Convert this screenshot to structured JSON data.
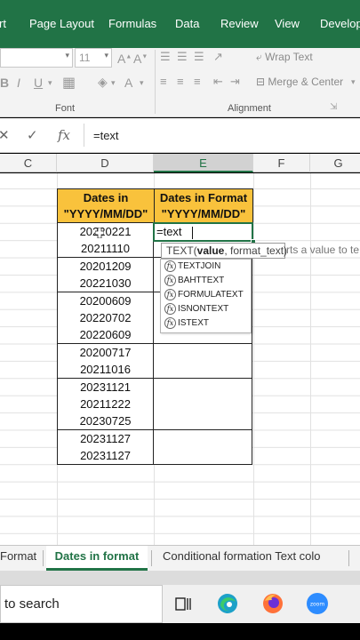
{
  "ribbon_tabs": [
    "rt",
    "Page Layout",
    "Formulas",
    "Data",
    "Review",
    "View",
    "Develope"
  ],
  "ribbon": {
    "font_size": "11",
    "font_group_label": "Font",
    "alignment_group_label": "Alignment",
    "wrap_text": "Wrap Text",
    "merge_center": "Merge & Center"
  },
  "formula_bar": {
    "value": "=text"
  },
  "column_headers": [
    "C",
    "D",
    "E",
    "F",
    "G"
  ],
  "active_column": "E",
  "table": {
    "header_d": [
      "Dates in",
      "\"YYYY/MM/DD\""
    ],
    "header_e": [
      "Dates in Format",
      "\"YYYY/MM/DD\""
    ],
    "dates": [
      "20220221",
      "20211110",
      "20201209",
      "20221030",
      "20200609",
      "20220702",
      "20220609",
      "20200717",
      "20211016",
      "20231121",
      "20211222",
      "20230725",
      "20231127",
      "20231127"
    ]
  },
  "active_cell_value": "=text",
  "tooltip": {
    "fn": "TEXT(",
    "arg1": "value",
    "rest": ", format_text)",
    "desc": "rts a value to te"
  },
  "autocomplete": [
    "TEXTJOIN",
    "BAHTTEXT",
    "FORMULATEXT",
    "ISNONTEXT",
    "ISTEXT"
  ],
  "sheet_tabs": [
    "Format",
    "Dates in format",
    "Conditional formation Text colo"
  ],
  "active_sheet": "Dates in format",
  "taskbar": {
    "search_text": "to search"
  },
  "colors": {
    "excel_green": "#217346",
    "header_fill": "#f9c23c"
  }
}
